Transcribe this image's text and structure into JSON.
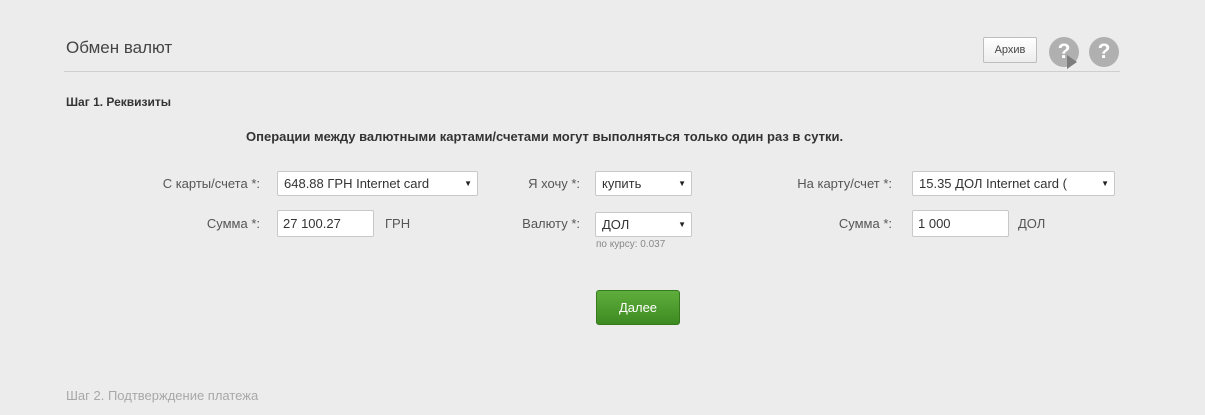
{
  "header": {
    "title": "Обмен валют",
    "archive_label": "Архив",
    "help_glyph": "?",
    "icons": [
      "help-play-icon",
      "help-icon"
    ]
  },
  "step1": {
    "title": "Шаг 1. Реквизиты",
    "notice": "Операции между валютными картами/счетами могут выполняться только один раз в сутки."
  },
  "form": {
    "from_card_label": "С карты/счета *:",
    "from_card_value": "648.88 ГРН  Internet card",
    "amount_label": "Сумма *:",
    "amount_value": "27 100.27",
    "amount_unit": "ГРН",
    "want_label": "Я хочу *:",
    "want_value": "купить",
    "currency_label": "Валюту *:",
    "currency_value": "ДОЛ",
    "rate_note": "по курсу: 0.037",
    "to_card_label": "На карту/счет *:",
    "to_card_value": "15.35 ДОЛ  Internet card (",
    "to_amount_label": "Сумма *:",
    "to_amount_value": "1 000",
    "to_amount_unit": "ДОЛ",
    "caret": "▼"
  },
  "actions": {
    "next_label": "Далее"
  },
  "step2": {
    "title": "Шаг 2. Подтверждение платежа"
  },
  "colors": {
    "accent_green": "#4a9a2c",
    "background": "#ececec",
    "icon_gray": "#b0b0b0"
  }
}
